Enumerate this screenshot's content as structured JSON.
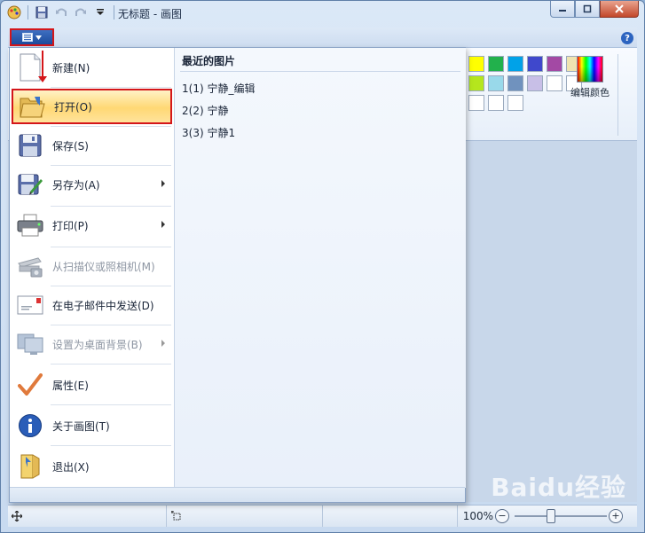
{
  "window": {
    "title": "无标题 - 画图"
  },
  "file_menu": {
    "recent_title": "最近的图片",
    "items": [
      {
        "label": "新建(N)",
        "disabled": false,
        "submenu": false
      },
      {
        "label": "打开(O)",
        "disabled": false,
        "submenu": false,
        "active": true
      },
      {
        "label": "保存(S)",
        "disabled": false,
        "submenu": false
      },
      {
        "label": "另存为(A)",
        "disabled": false,
        "submenu": true
      },
      {
        "label": "打印(P)",
        "disabled": false,
        "submenu": true
      },
      {
        "label": "从扫描仪或照相机(M)",
        "disabled": true,
        "submenu": false
      },
      {
        "label": "在电子邮件中发送(D)",
        "disabled": false,
        "submenu": false
      },
      {
        "label": "设置为桌面背景(B)",
        "disabled": true,
        "submenu": true
      },
      {
        "label": "属性(E)",
        "disabled": false,
        "submenu": false
      },
      {
        "label": "关于画图(T)",
        "disabled": false,
        "submenu": false
      },
      {
        "label": "退出(X)",
        "disabled": false,
        "submenu": false
      }
    ],
    "recent": [
      {
        "label": "1(1)  宁静_编辑"
      },
      {
        "label": "2(2)  宁静"
      },
      {
        "label": "3(3)  宁静1"
      }
    ]
  },
  "ribbon": {
    "edit_colors_label": "编辑颜色",
    "palette_colors": [
      "#ffff00",
      "#22b14c",
      "#00a2e8",
      "#3f48cc",
      "#a349a4",
      "#efe4b0",
      "#b5e61d",
      "#99d9ea",
      "#7092be",
      "#c8bfe7",
      "#ffffff",
      "#ffffff",
      "#ffffff",
      "#ffffff",
      "#ffffff"
    ]
  },
  "statusbar": {
    "zoom_label": "100%",
    "zoom_out": "−",
    "zoom_in": "+"
  },
  "watermark": {
    "text": "Baidu经验"
  }
}
